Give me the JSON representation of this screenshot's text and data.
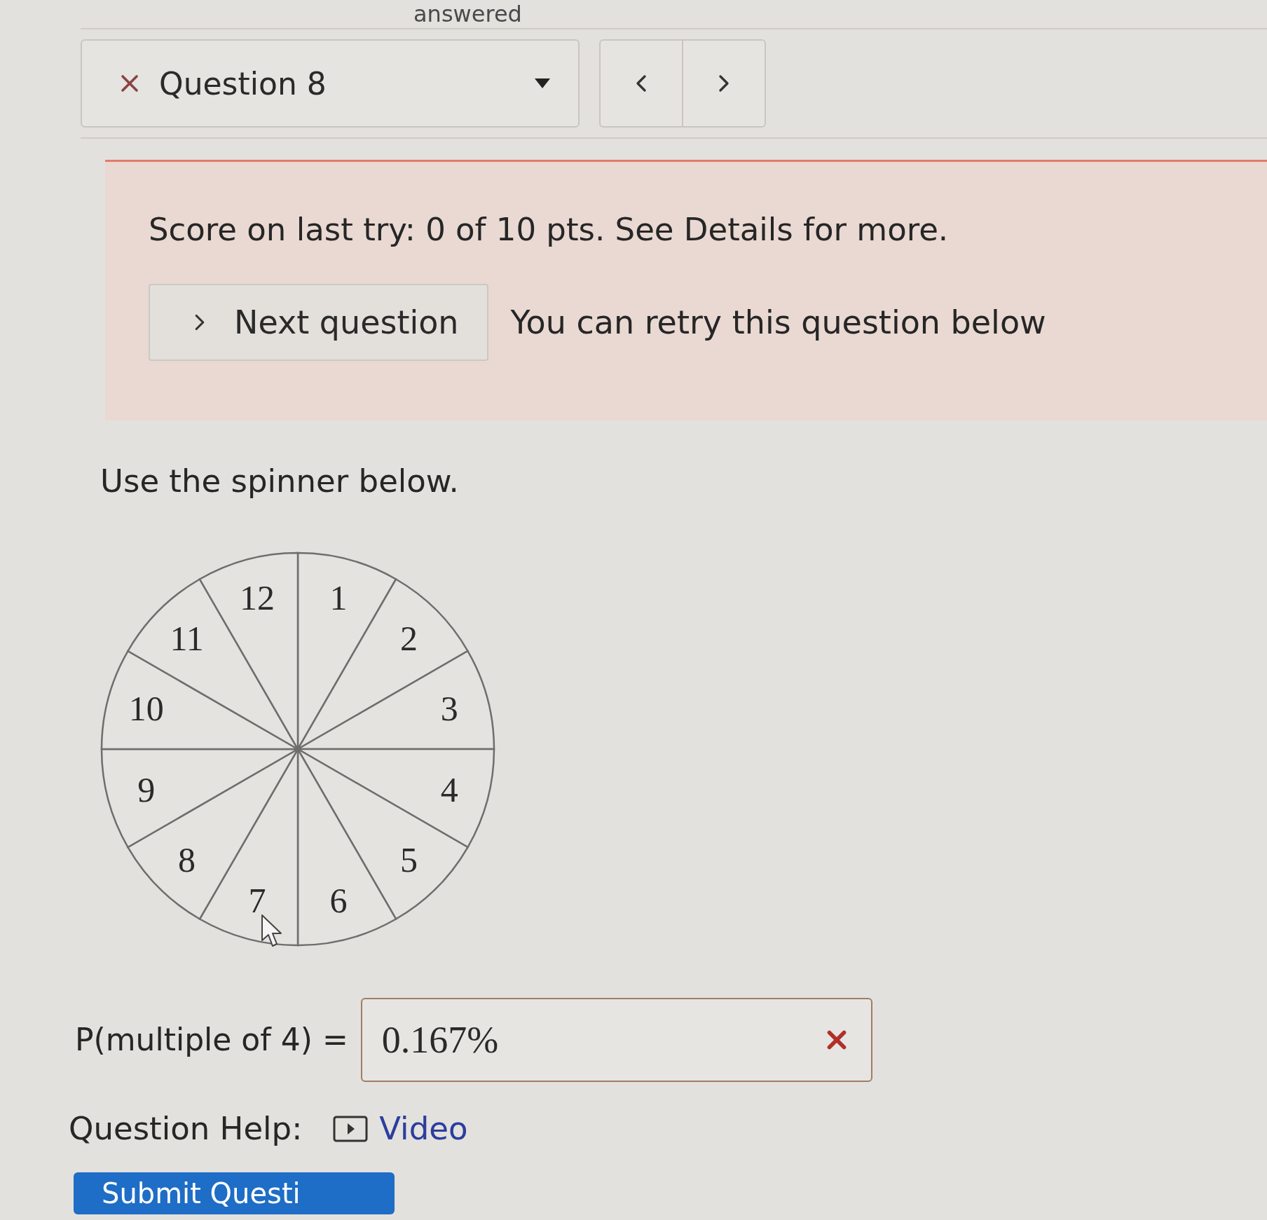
{
  "header": {
    "status_text": "answered"
  },
  "question_nav": {
    "label": "Question 8",
    "correct": false
  },
  "alert": {
    "score_text": "Score on last try: 0 of 10 pts. See Details for more.",
    "next_button": "Next question",
    "retry_text": "You can retry this question below"
  },
  "question": {
    "prompt": "Use the spinner below.",
    "spinner": {
      "sections": [
        "1",
        "2",
        "3",
        "4",
        "5",
        "6",
        "7",
        "8",
        "9",
        "10",
        "11",
        "12"
      ]
    },
    "answer": {
      "label": "P(multiple of 4) =",
      "value": "0.167%",
      "correct": false
    }
  },
  "help": {
    "label": "Question Help:",
    "link": "Video"
  },
  "submit_button": "Submit Questi"
}
